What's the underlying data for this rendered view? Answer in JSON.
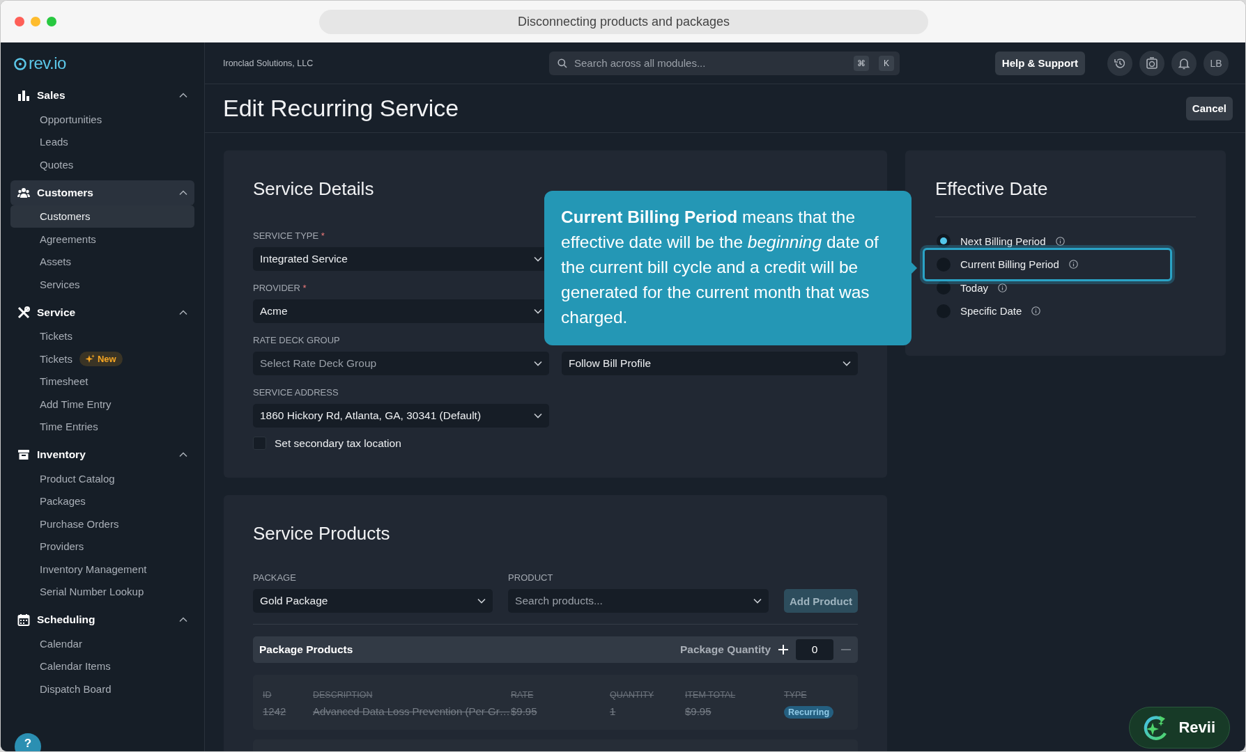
{
  "window": {
    "title": "Disconnecting products and packages"
  },
  "sidebar": {
    "logo": "rev.io",
    "groups": [
      {
        "label": "Sales",
        "expanded": true,
        "selected": false,
        "items": [
          {
            "label": "Opportunities",
            "selected": false
          },
          {
            "label": "Leads",
            "selected": false
          },
          {
            "label": "Quotes",
            "selected": false
          }
        ]
      },
      {
        "label": "Customers",
        "expanded": true,
        "selected": true,
        "items": [
          {
            "label": "Customers",
            "selected": true
          },
          {
            "label": "Agreements",
            "selected": false
          },
          {
            "label": "Assets",
            "selected": false
          },
          {
            "label": "Services",
            "selected": false
          }
        ]
      },
      {
        "label": "Service",
        "expanded": true,
        "selected": false,
        "items": [
          {
            "label": "Tickets",
            "selected": false
          },
          {
            "label": "Tickets",
            "selected": false,
            "badge": "New"
          },
          {
            "label": "Timesheet",
            "selected": false
          },
          {
            "label": "Add Time Entry",
            "selected": false
          },
          {
            "label": "Time Entries",
            "selected": false
          }
        ]
      },
      {
        "label": "Inventory",
        "expanded": true,
        "selected": false,
        "items": [
          {
            "label": "Product Catalog",
            "selected": false
          },
          {
            "label": "Packages",
            "selected": false
          },
          {
            "label": "Purchase Orders",
            "selected": false
          },
          {
            "label": "Providers",
            "selected": false
          },
          {
            "label": "Inventory Management",
            "selected": false
          },
          {
            "label": "Serial Number Lookup",
            "selected": false
          }
        ]
      },
      {
        "label": "Scheduling",
        "expanded": true,
        "selected": false,
        "items": [
          {
            "label": "Calendar",
            "selected": false
          },
          {
            "label": "Calendar Items",
            "selected": false
          },
          {
            "label": "Dispatch Board",
            "selected": false
          }
        ]
      }
    ],
    "help": "?"
  },
  "topbar": {
    "company": "Ironclad Solutions, LLC",
    "search": {
      "placeholder": "Search across all modules...",
      "keys": [
        "⌘",
        "K"
      ]
    },
    "help_button": "Help & Support",
    "avatar": "LB"
  },
  "page": {
    "title": "Edit Recurring Service",
    "cancel": "Cancel"
  },
  "service_details": {
    "title": "Service Details",
    "rows": [
      [
        {
          "label": "SERVICE TYPE",
          "required_mark": "*",
          "value": "Integrated Service"
        }
      ],
      [
        {
          "label": "PROVIDER",
          "required_mark": "*",
          "value": "Acme"
        }
      ],
      [
        {
          "label": "RATE DECK GROUP",
          "placeholder": "Select Rate Deck Group"
        },
        {
          "value": "Follow Bill Profile"
        }
      ],
      [
        {
          "label": "SERVICE ADDRESS",
          "value": "1860 Hickory Rd, Atlanta, GA, 30341 (Default)"
        }
      ]
    ],
    "checkbox": {
      "label": "Set secondary tax location",
      "checked": false
    }
  },
  "effective_date": {
    "title": "Effective Date",
    "options": [
      {
        "label": "Next Billing Period",
        "selected": true,
        "highlighted": false
      },
      {
        "label": "Current Billing Period",
        "selected": false,
        "highlighted": true
      },
      {
        "label": "Today",
        "selected": false,
        "highlighted": false
      },
      {
        "label": "Specific Date",
        "selected": false,
        "highlighted": false
      }
    ]
  },
  "tooltip": {
    "text": "**Current Billing Period** means that the effective date will be the *beginning* date of the current bill cycle and a credit will be generated for the current month that was charged."
  },
  "service_products": {
    "title": "Service Products",
    "package": {
      "label": "PACKAGE",
      "value": "Gold Package"
    },
    "product": {
      "label": "PRODUCT",
      "placeholder": "Search products..."
    },
    "add_button": {
      "label": "Add Product",
      "disabled": true
    },
    "package_products": {
      "title": "Package Products",
      "quantity_label": "Package Quantity",
      "quantity": "0"
    },
    "table": {
      "columns": [
        "ID",
        "DESCRIPTION",
        "RATE",
        "QUANTITY",
        "ITEM TOTAL",
        "TYPE"
      ],
      "rows": [
        {
          "cells": [
            "1242",
            "Advanced Data Loss Prevention (Per Gr…",
            "$9.95",
            "1",
            "$9.95"
          ],
          "type": "Recurring",
          "struck": true
        }
      ]
    }
  },
  "assistant": {
    "label": "Revii"
  }
}
